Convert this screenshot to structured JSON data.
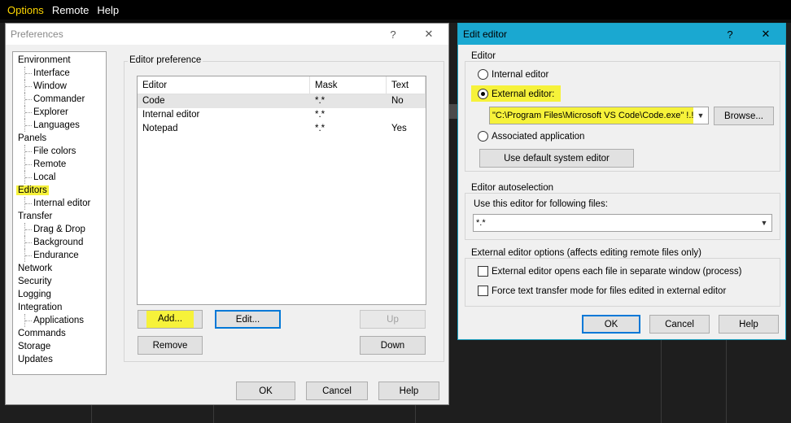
{
  "menubar": {
    "items": [
      "Options",
      "Remote",
      "Help"
    ]
  },
  "preferences": {
    "title": "Preferences",
    "help_btn": "?",
    "close_btn": "✕",
    "tree": [
      {
        "label": "Environment",
        "level": 0
      },
      {
        "label": "Interface",
        "level": 1
      },
      {
        "label": "Window",
        "level": 1
      },
      {
        "label": "Commander",
        "level": 1
      },
      {
        "label": "Explorer",
        "level": 1
      },
      {
        "label": "Languages",
        "level": 1
      },
      {
        "label": "Panels",
        "level": 0
      },
      {
        "label": "File colors",
        "level": 1
      },
      {
        "label": "Remote",
        "level": 1
      },
      {
        "label": "Local",
        "level": 1
      },
      {
        "label": "Editors",
        "level": 0,
        "selected": true
      },
      {
        "label": "Internal editor",
        "level": 1
      },
      {
        "label": "Transfer",
        "level": 0
      },
      {
        "label": "Drag & Drop",
        "level": 1
      },
      {
        "label": "Background",
        "level": 1
      },
      {
        "label": "Endurance",
        "level": 1
      },
      {
        "label": "Network",
        "level": 0
      },
      {
        "label": "Security",
        "level": 0
      },
      {
        "label": "Logging",
        "level": 0
      },
      {
        "label": "Integration",
        "level": 0
      },
      {
        "label": "Applications",
        "level": 1
      },
      {
        "label": "Commands",
        "level": 0
      },
      {
        "label": "Storage",
        "level": 0
      },
      {
        "label": "Updates",
        "level": 0
      }
    ],
    "group_label": "Editor preference",
    "list": {
      "headers": [
        "Editor",
        "Mask",
        "Text"
      ],
      "rows": [
        [
          "Code",
          "*.*",
          "No"
        ],
        [
          "Internal editor",
          "*.*",
          ""
        ],
        [
          "Notepad",
          "*.*",
          "Yes"
        ]
      ]
    },
    "buttons": {
      "add": "Add...",
      "edit": "Edit...",
      "up": "Up",
      "remove": "Remove",
      "down": "Down",
      "ok": "OK",
      "cancel": "Cancel",
      "help": "Help"
    }
  },
  "edit_editor": {
    "title": "Edit editor",
    "help_btn": "?",
    "close_btn": "✕",
    "editor_group": "Editor",
    "internal_label": "Internal editor",
    "external_label": "External editor:",
    "external_value": "\"C:\\Program Files\\Microsoft VS Code\\Code.exe\" !.!",
    "browse": "Browse...",
    "associated_label": "Associated application",
    "default_system": "Use default system editor",
    "autoselect_group": "Editor autoselection",
    "use_for_label": "Use this editor for following files:",
    "mask_value": "*.*",
    "options_group": "External editor options (affects editing remote files only)",
    "opt1": "External editor opens each file in separate window (process)",
    "opt2": "Force text transfer mode for files edited in external editor",
    "ok": "OK",
    "cancel": "Cancel",
    "help": "Help"
  },
  "colors": {
    "highlight": "#f6f23a",
    "accent": "#1aa8d1"
  }
}
